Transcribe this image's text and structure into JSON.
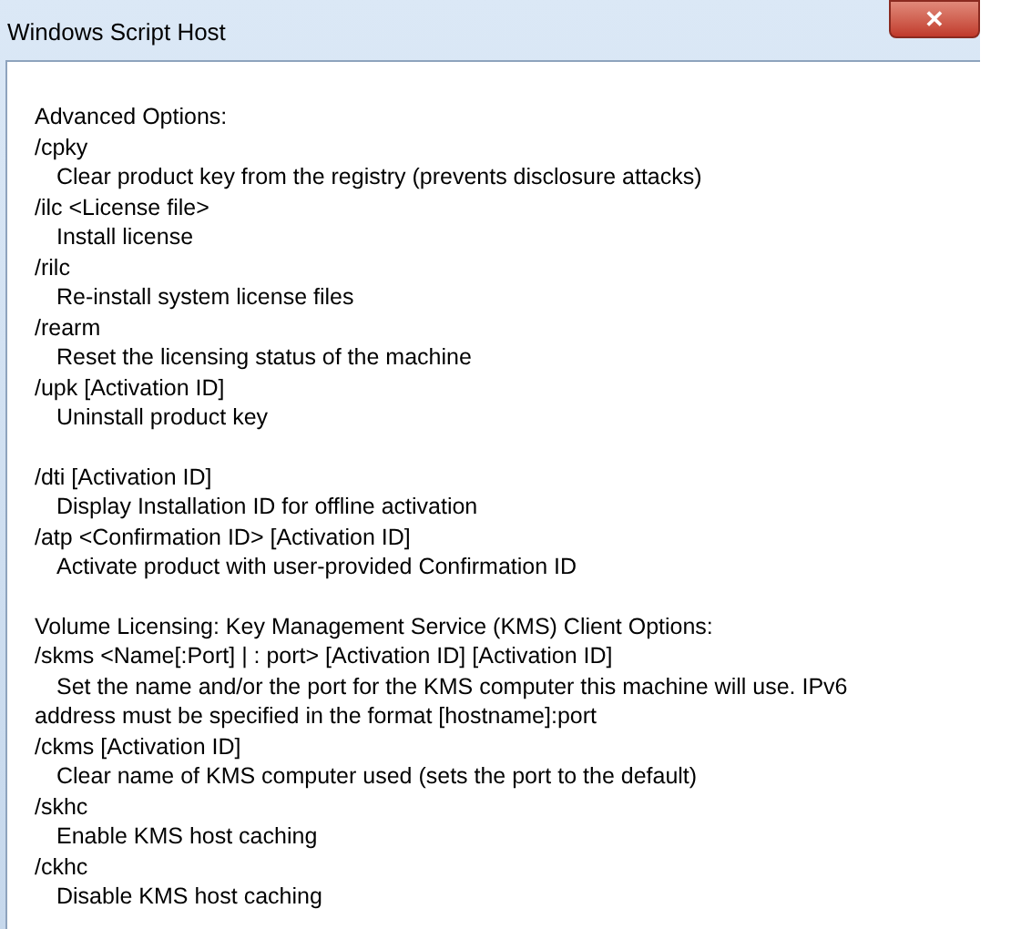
{
  "window": {
    "title": "Windows Script Host",
    "close": "✕"
  },
  "sections": [
    {
      "entries": [
        {
          "kind": "heading",
          "text": "Advanced Options:"
        },
        {
          "kind": "option",
          "text": "/cpky"
        },
        {
          "kind": "description",
          "text": "Clear product key from the registry (prevents disclosure attacks)"
        },
        {
          "kind": "option",
          "text": "/ilc <License file>"
        },
        {
          "kind": "description",
          "text": "Install license"
        },
        {
          "kind": "option",
          "text": "/rilc"
        },
        {
          "kind": "description",
          "text": "Re-install system license files"
        },
        {
          "kind": "option",
          "text": "/rearm"
        },
        {
          "kind": "description",
          "text": "Reset the licensing status of the machine"
        },
        {
          "kind": "option",
          "text": "/upk [Activation ID]"
        },
        {
          "kind": "description",
          "text": "Uninstall product key"
        }
      ]
    },
    {
      "entries": [
        {
          "kind": "option",
          "text": "/dti [Activation ID]"
        },
        {
          "kind": "description",
          "text": "Display Installation ID for offline activation"
        },
        {
          "kind": "option",
          "text": "/atp <Confirmation ID> [Activation ID]"
        },
        {
          "kind": "description",
          "text": "Activate product with user-provided Confirmation ID"
        }
      ]
    },
    {
      "entries": [
        {
          "kind": "heading",
          "text": "Volume Licensing: Key Management Service (KMS) Client Options:"
        },
        {
          "kind": "option",
          "text": "/skms <Name[:Port] | : port> [Activation ID] [Activation ID]"
        },
        {
          "kind": "description",
          "text": "Set the name and/or the port for the KMS computer this machine will use. IPv6 address must be specified in the format [hostname]:port"
        },
        {
          "kind": "option",
          "text": "/ckms [Activation ID]"
        },
        {
          "kind": "description",
          "text": "Clear name of KMS computer used (sets the port to the default)"
        },
        {
          "kind": "option",
          "text": "/skhc"
        },
        {
          "kind": "description",
          "text": "Enable KMS host caching"
        },
        {
          "kind": "option",
          "text": "/ckhc"
        },
        {
          "kind": "description",
          "text": "Disable KMS host caching"
        }
      ]
    }
  ]
}
